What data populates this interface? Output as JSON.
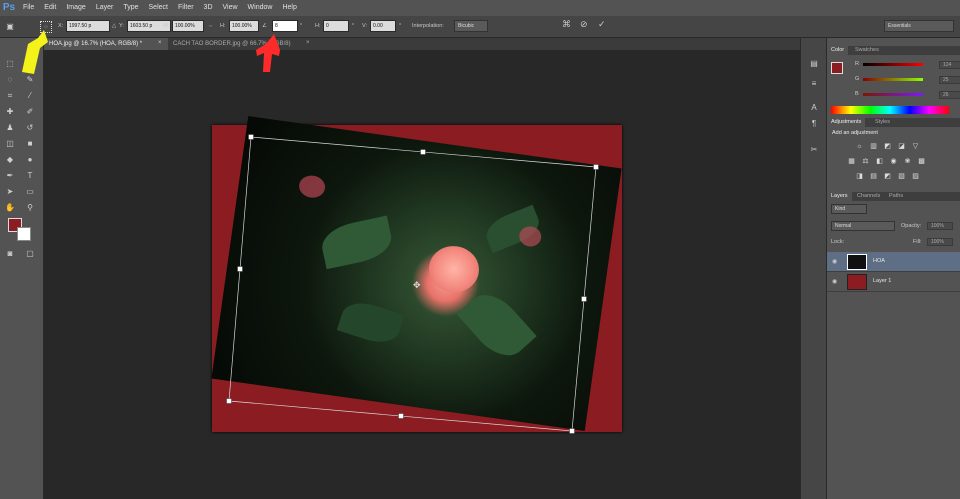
{
  "app": {
    "logo": "Ps"
  },
  "menu": [
    "File",
    "Edit",
    "Image",
    "Layer",
    "Type",
    "Select",
    "Filter",
    "3D",
    "View",
    "Window",
    "Help"
  ],
  "options": {
    "x_label": "X:",
    "x_value": "1997.50 p",
    "y_label": "Y:",
    "y_value": "1603.50 p",
    "w_label": "W:",
    "w_value": "100.00%",
    "h_label": "H:",
    "h_value": "100.00%",
    "angle_value": "8",
    "hskew_label": "H:",
    "hskew_value": "0",
    "vskew_label": "V:",
    "vskew_value": "0.00",
    "degree_symbol": "°",
    "interp_label": "Interpolation:",
    "interp_value": "Bicubic",
    "workspace": "Essentials"
  },
  "tabs": [
    {
      "label": "HOA.jpg @ 16.7% (HOA, RGB/8) *",
      "active": true
    },
    {
      "label": "CACH TAO BORDER.jpg @ 66.7% (RGB/8)",
      "active": false
    }
  ],
  "colors": {
    "foreground": "#8b1c22",
    "background": "#ffffff",
    "accent_arrow_yellow": "#f3f31a",
    "accent_arrow_red": "#ff2a2a"
  },
  "panels": {
    "color_tabs": [
      "Color",
      "Swatches"
    ],
    "color_values": {
      "r_label": "R",
      "r": "124",
      "g_label": "G",
      "g": "25",
      "b_label": "B",
      "b": "26"
    },
    "adjust_tabs": [
      "Adjustments",
      "Styles"
    ],
    "adjust_title": "Add an adjustment",
    "layers_tabs": [
      "Layers",
      "Channels",
      "Paths"
    ],
    "kind_label": "Kind",
    "blend_mode": "Normal",
    "opacity_label": "Opacity:",
    "opacity_value": "100%",
    "lock_label": "Lock:",
    "fill_label": "Fill:",
    "fill_value": "100%",
    "layers": [
      {
        "name": "HOA",
        "selected": true
      },
      {
        "name": "Layer 1",
        "selected": false
      }
    ]
  }
}
